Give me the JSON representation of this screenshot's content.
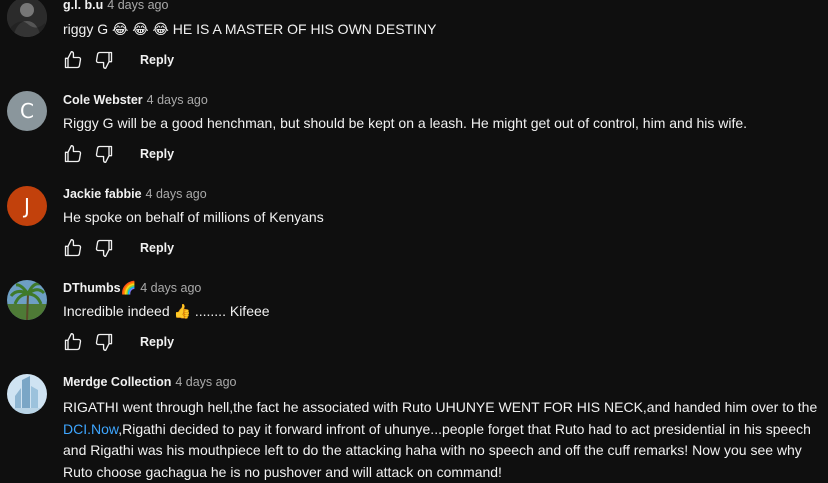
{
  "comments": [
    {
      "author": "g.l. b.u",
      "time": "4 days ago",
      "text": "riggy G 😂 😂 😂  HE IS A MASTER OF HIS OWN DESTINY",
      "reply_label": "Reply"
    },
    {
      "author": "Cole Webster",
      "time": "4 days ago",
      "avatar_letter": "C",
      "avatar_color": "#8a969c",
      "text": "Riggy G will be a good henchman, but should be kept on a leash. He might get out of control, him and his wife.",
      "reply_label": "Reply"
    },
    {
      "author": "Jackie fabbie",
      "time": "4 days ago",
      "avatar_letter": "J",
      "avatar_color": "#c2410c",
      "text": "He spoke on behalf of millions of Kenyans",
      "reply_label": "Reply"
    },
    {
      "author": "DThumbs🌈",
      "time": "4 days ago",
      "text": "Incredible indeed 👍 ........ Kifeee",
      "reply_label": "Reply"
    },
    {
      "author": "Merdge Collection",
      "time": "4 days ago",
      "text_before_link": "RIGATHI went  through hell,the fact he associated with Ruto UHUNYE WENT FOR HIS NECK,and handed him over to the ",
      "link": "DCI.Now",
      "text_after_link": ",Rigathi decided to pay it forward infront  of uhunye...people forget that Ruto had to act presidential  in his speech and Rigathi was his mouthpiece left to do the attacking haha with no speech and off the cuff remarks! Now you see why Ruto choose gachagua  he is no pushover and will attack on command!"
    }
  ],
  "colors": {
    "background": "#0f0f0f",
    "text": "#f1f1f1",
    "secondary_text": "#aaaaaa",
    "link": "#3ea6ff"
  },
  "icons": [
    "thumbs-up-icon",
    "thumbs-down-icon"
  ]
}
